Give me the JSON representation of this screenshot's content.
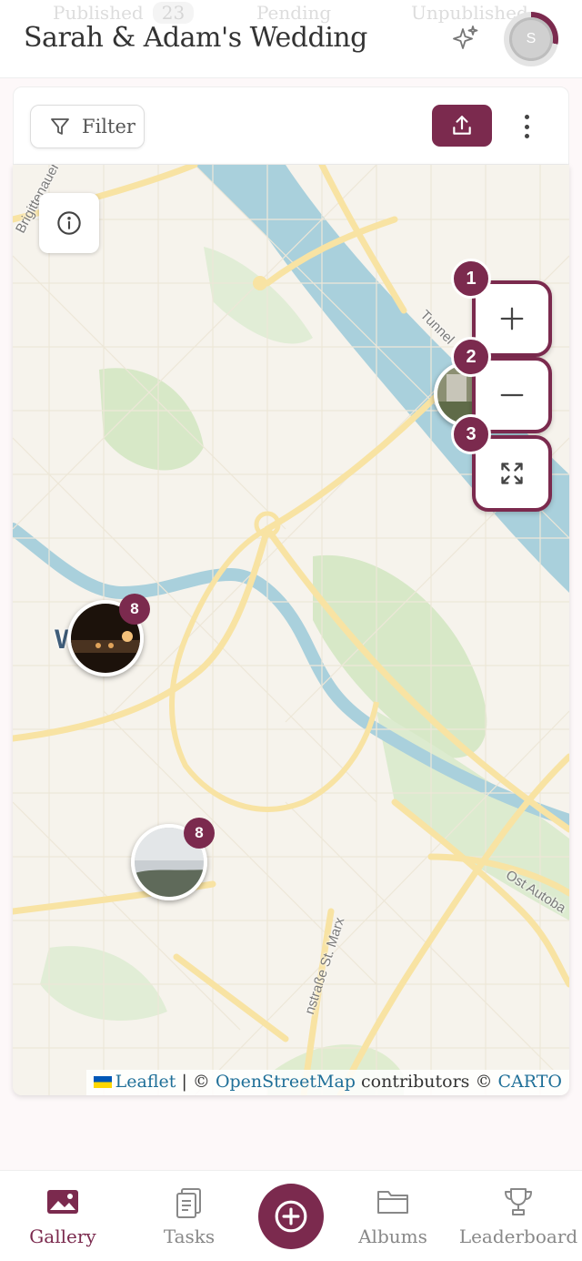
{
  "header": {
    "title": "Sarah & Adam's Wedding",
    "ghost_tabs": [
      {
        "label": "Published",
        "count": "23"
      },
      {
        "label": "Pending",
        "count": ""
      },
      {
        "label": "Unpublished",
        "count": ""
      }
    ],
    "avatar_initial": "S",
    "sparkle_icon": "sparkles-icon"
  },
  "toolbar": {
    "filter_label": "Filter",
    "upload_icon": "upload-icon",
    "more_icon": "more-vertical-icon"
  },
  "map": {
    "zoom_badges": [
      "1",
      "2",
      "3"
    ],
    "clusters": [
      {
        "count": "8"
      },
      {
        "count": "8"
      }
    ],
    "labels": {
      "street_1": "Brigittenauer L",
      "street_2": "Tunnel",
      "street_3": "Ost Autoba",
      "street_4": "nstraße St. Marx",
      "district": "W"
    },
    "attribution": {
      "leaflet": "Leaflet",
      "sep1": " | © ",
      "osm": "OpenStreetMap",
      "contrib": " contributors © ",
      "carto": "CARTO"
    }
  },
  "bottom_nav": {
    "items": [
      {
        "label": "Gallery",
        "icon": "image-icon",
        "active": true
      },
      {
        "label": "Tasks",
        "icon": "clipboard-icon",
        "active": false
      },
      {
        "label": "Albums",
        "icon": "folder-icon",
        "active": false
      },
      {
        "label": "Leaderboard",
        "icon": "trophy-icon",
        "active": false
      }
    ],
    "fab_icon": "plus-circle-icon"
  },
  "colors": {
    "accent": "#7b2a4e",
    "link": "#1f6f98",
    "water": "#a9d0dc",
    "park": "#d7e8c7",
    "road": "#f8e3a3"
  }
}
